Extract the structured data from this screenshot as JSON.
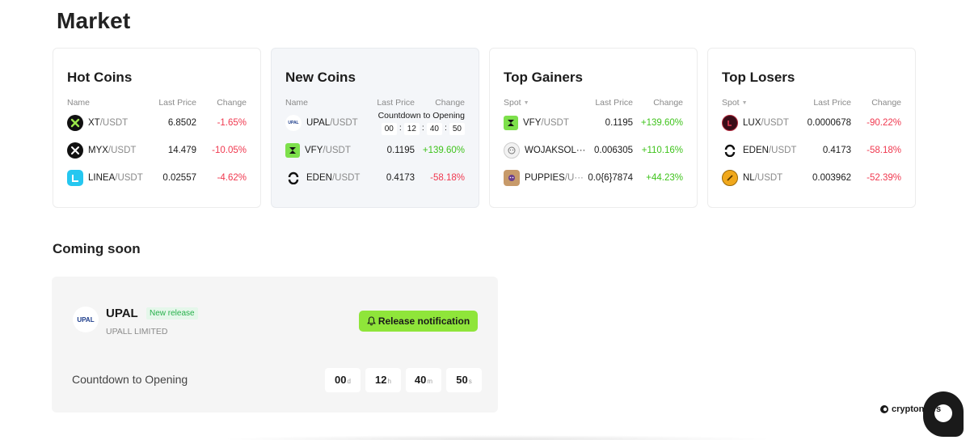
{
  "page": {
    "title": "Market"
  },
  "hot_coins": {
    "title": "Hot Coins",
    "columns": [
      "Name",
      "Last Price",
      "Change"
    ],
    "rows": [
      {
        "base": "XT",
        "quote": "/USDT",
        "price": "6.8502",
        "change": "-1.65%",
        "icon": "xt-logo-icon",
        "icon_color": "#111111",
        "direction": "neg"
      },
      {
        "base": "MYX",
        "quote": "/USDT",
        "price": "14.479",
        "change": "-10.05%",
        "icon": "myx-logo-icon",
        "icon_color": "#111111",
        "direction": "neg"
      },
      {
        "base": "LINEA",
        "quote": "/USDT",
        "price": "0.02557",
        "change": "-4.62%",
        "icon": "linea-logo-icon",
        "icon_color": "#25c7f0",
        "direction": "neg"
      }
    ]
  },
  "new_coins": {
    "title": "New Coins",
    "columns": [
      "Name",
      "Last Price",
      "Change"
    ],
    "countdown_label": "Countdown to Opening",
    "countdown": [
      "00",
      "12",
      "40",
      "50"
    ],
    "rows": [
      {
        "base": "UPAL",
        "quote": "/USDT",
        "icon": "upal-logo-icon"
      },
      {
        "base": "VFY",
        "quote": "/USDT",
        "price": "0.1195",
        "change": "+139.60%",
        "icon": "vfy-logo-icon",
        "icon_color": "#7de04b",
        "direction": "pos"
      },
      {
        "base": "EDEN",
        "quote": "/USDT",
        "price": "0.4173",
        "change": "-58.18%",
        "icon": "eden-logo-icon",
        "icon_color": "#111111",
        "direction": "neg"
      }
    ]
  },
  "top_gainers": {
    "title": "Top Gainers",
    "columns": [
      "Spot",
      "Last Price",
      "Change"
    ],
    "rows": [
      {
        "base": "VFY",
        "quote": "/USDT",
        "price": "0.1195",
        "change": "+139.60%",
        "icon": "vfy-logo-icon",
        "icon_color": "#7de04b",
        "direction": "pos"
      },
      {
        "base": "WOJAKSOL···",
        "quote": "",
        "price": "0.006305",
        "change": "+110.16%",
        "icon": "wojak-logo-icon",
        "icon_color": "#e8e8e8",
        "direction": "pos"
      },
      {
        "base": "PUPPIES",
        "quote": "/U···",
        "price": "0.0{6}7874",
        "change": "+44.23%",
        "icon": "puppies-logo-icon",
        "icon_color": "#c79a6a",
        "direction": "pos"
      }
    ]
  },
  "top_losers": {
    "title": "Top Losers",
    "columns": [
      "Spot",
      "Last Price",
      "Change"
    ],
    "rows": [
      {
        "base": "LUX",
        "quote": "/USDT",
        "price": "0.0000678",
        "change": "-90.22%",
        "icon": "lux-logo-icon",
        "icon_color": "#7a1a2a",
        "direction": "neg"
      },
      {
        "base": "EDEN",
        "quote": "/USDT",
        "price": "0.4173",
        "change": "-58.18%",
        "icon": "eden-logo-icon",
        "icon_color": "#111111",
        "direction": "neg"
      },
      {
        "base": "NL",
        "quote": "/USDT",
        "price": "0.003962",
        "change": "-52.39%",
        "icon": "nl-logo-icon",
        "icon_color": "#f0a81c",
        "direction": "neg"
      }
    ]
  },
  "coming_soon": {
    "title": "Coming soon",
    "name": "UPAL",
    "badge": "New release",
    "company": "UPALL LIMITED",
    "logo_text": "UPAL",
    "button_label": "Release notification",
    "countdown_label": "Countdown to Opening",
    "timer": [
      {
        "value": "00",
        "unit": "d"
      },
      {
        "value": "12",
        "unit": "h"
      },
      {
        "value": "40",
        "unit": "m"
      },
      {
        "value": "50",
        "unit": "s"
      }
    ]
  },
  "watermark": {
    "text": "cryptonews"
  },
  "colors": {
    "positive": "#3fc31c",
    "negative": "#f0384f",
    "accent": "#8fe53a"
  }
}
